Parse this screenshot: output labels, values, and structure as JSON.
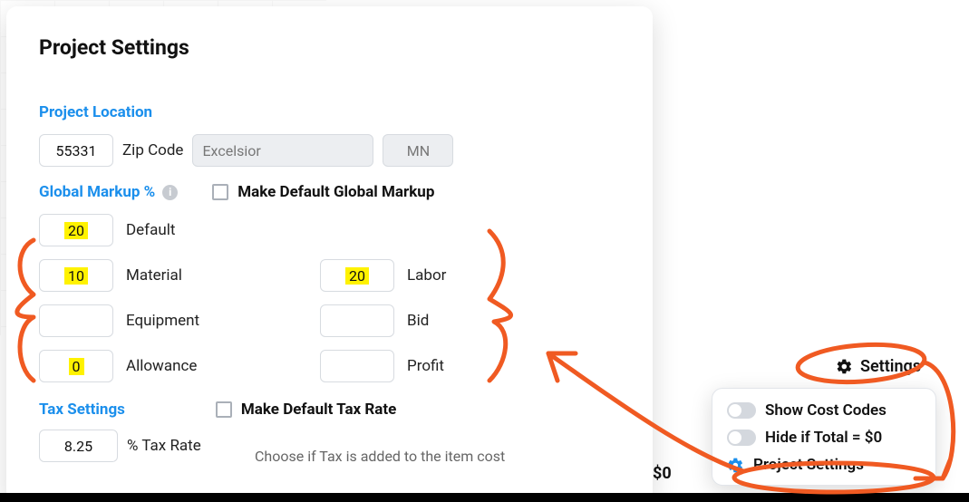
{
  "modal": {
    "title": "Project Settings",
    "location": {
      "heading": "Project Location",
      "zip": "55331",
      "zip_label": "Zip Code",
      "city": "Excelsior",
      "state": "MN"
    },
    "markup": {
      "heading": "Global Markup %",
      "make_default_label": "Make Default Global Markup",
      "items": {
        "default": {
          "value": "20",
          "label": "Default"
        },
        "material": {
          "value": "10",
          "label": "Material"
        },
        "equipment": {
          "value": "",
          "label": "Equipment"
        },
        "allowance": {
          "value": "0",
          "label": "Allowance"
        },
        "labor": {
          "value": "20",
          "label": "Labor"
        },
        "bid": {
          "value": "",
          "label": "Bid"
        },
        "profit": {
          "value": "",
          "label": "Profit"
        }
      }
    },
    "tax": {
      "heading": "Tax Settings",
      "make_default_label": "Make Default Tax Rate",
      "rate": "8.25",
      "rate_label": "% Tax Rate",
      "hint": "Choose if Tax is added to the item cost"
    }
  },
  "right": {
    "settings_label": "Settings",
    "popover": {
      "show_codes": "Show Cost Codes",
      "hide_zero": "Hide if Total = $0",
      "project_settings": "Project Settings"
    },
    "dollar": "$0"
  }
}
